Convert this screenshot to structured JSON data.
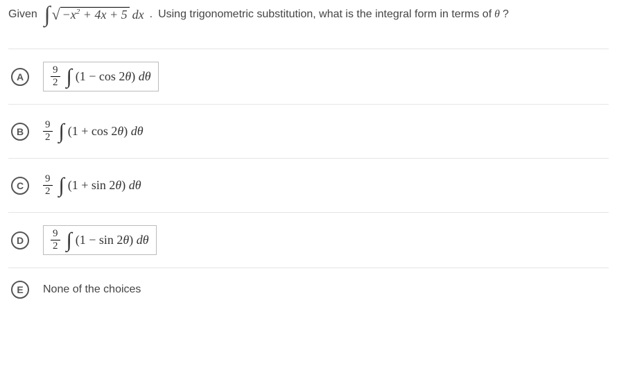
{
  "question": {
    "prefix": "Given",
    "integral_radicand": "−x² + 4x + 5",
    "dx": "dx",
    "period": ".",
    "text_after": "Using trigonometric substitution, what is the integral form in terms of",
    "theta_var": "θ",
    "qmark": "?"
  },
  "choices": [
    {
      "letter": "A",
      "frac_num": "9",
      "frac_den": "2",
      "inner": "(1 − cos 2θ) dθ",
      "boxed": true
    },
    {
      "letter": "B",
      "frac_num": "9",
      "frac_den": "2",
      "inner": "(1 + cos 2θ) dθ",
      "boxed": false
    },
    {
      "letter": "C",
      "frac_num": "9",
      "frac_den": "2",
      "inner": "(1 + sin 2θ) dθ",
      "boxed": false
    },
    {
      "letter": "D",
      "frac_num": "9",
      "frac_den": "2",
      "inner": "(1 − sin 2θ) dθ",
      "boxed": true
    },
    {
      "letter": "E",
      "text": "None of the choices",
      "plain": true
    }
  ]
}
